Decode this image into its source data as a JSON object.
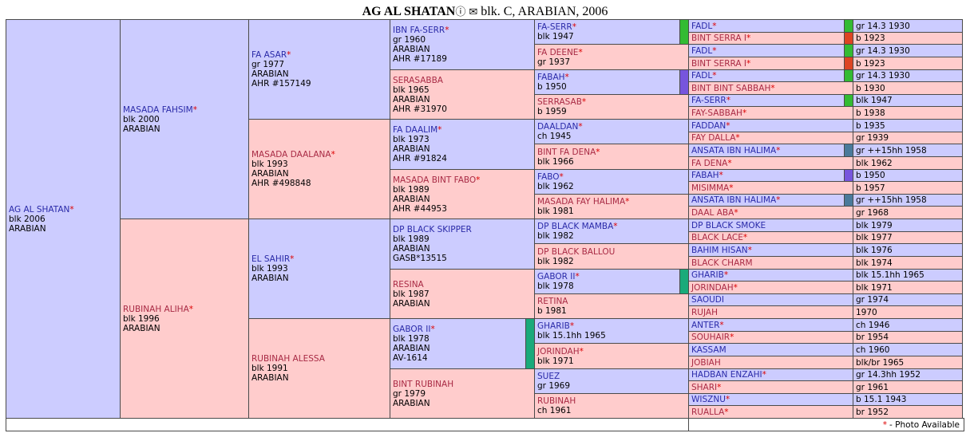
{
  "header": {
    "name": "AG AL SHATAN",
    "info_glyph": "ⓘ",
    "photo_glyph": "✉",
    "details": "blk. C, ARABIAN, 2006"
  },
  "footer": {
    "star": "*",
    "note": "- Photo Available"
  },
  "colors": {
    "male_bg": "#ccccff",
    "female_bg": "#ffcccc",
    "star": "#dd0000"
  },
  "gen1": {
    "name": "AG AL SHATAN",
    "star": true,
    "lines": [
      "blk 2006",
      "ARABIAN"
    ],
    "sex": "m"
  },
  "gen2": [
    {
      "name": "MASADA FAHSIM",
      "star": true,
      "lines": [
        "blk 2000",
        "ARABIAN"
      ],
      "sex": "m"
    },
    {
      "name": "RUBINAH ALIHA",
      "star": true,
      "lines": [
        "blk 1996",
        "ARABIAN"
      ],
      "sex": "f"
    }
  ],
  "gen3": [
    {
      "name": "FA ASAR",
      "star": true,
      "lines": [
        "gr 1977",
        "ARABIAN",
        "AHR #157149"
      ],
      "sex": "m"
    },
    {
      "name": "MASADA DAALANA",
      "star": true,
      "lines": [
        "blk 1993",
        "ARABIAN",
        "AHR #498848"
      ],
      "sex": "f"
    },
    {
      "name": "EL SAHIR",
      "star": true,
      "lines": [
        "blk 1993",
        "ARABIAN"
      ],
      "sex": "m"
    },
    {
      "name": "RUBINAH ALESSA",
      "star": false,
      "lines": [
        "blk 1991",
        "ARABIAN"
      ],
      "sex": "f"
    }
  ],
  "gen4": [
    {
      "name": "IBN FA-SERR",
      "star": true,
      "lines": [
        "gr 1960",
        "ARABIAN",
        "AHR #17189"
      ],
      "sex": "m",
      "swatch": ""
    },
    {
      "name": "SERASABBA",
      "star": false,
      "lines": [
        "blk 1965",
        "ARABIAN",
        "AHR #31970"
      ],
      "sex": "f",
      "swatch": ""
    },
    {
      "name": "FA DAALIM",
      "star": true,
      "lines": [
        "blk 1973",
        "ARABIAN",
        "AHR #91824"
      ],
      "sex": "m",
      "swatch": ""
    },
    {
      "name": "MASADA BINT FABO",
      "star": true,
      "lines": [
        "blk 1989",
        "ARABIAN",
        "AHR #44953"
      ],
      "sex": "f",
      "swatch": ""
    },
    {
      "name": "DP BLACK SKIPPER",
      "star": false,
      "lines": [
        "blk 1989",
        "ARABIAN",
        "GASB*13515"
      ],
      "sex": "m",
      "swatch": ""
    },
    {
      "name": "RESINA",
      "star": false,
      "lines": [
        "blk 1987",
        "ARABIAN"
      ],
      "sex": "f",
      "swatch": ""
    },
    {
      "name": "GABOR II",
      "star": true,
      "lines": [
        "blk 1978",
        "ARABIAN",
        "AV-1614"
      ],
      "sex": "m",
      "swatch": "#1aaa7a"
    },
    {
      "name": "BINT RUBINAH",
      "star": false,
      "lines": [
        "gr 1979",
        "ARABIAN"
      ],
      "sex": "f",
      "swatch": ""
    }
  ],
  "gen5": [
    {
      "name": "FA-SERR",
      "star": true,
      "lines": [
        "blk 1947"
      ],
      "sex": "m",
      "swatch": "#33bb33"
    },
    {
      "name": "FA DEENE",
      "star": true,
      "lines": [
        "gr 1937"
      ],
      "sex": "f",
      "swatch": ""
    },
    {
      "name": "FABAH",
      "star": true,
      "lines": [
        "b 1950"
      ],
      "sex": "m",
      "swatch": "#7755dd"
    },
    {
      "name": "SERRASAB",
      "star": true,
      "lines": [
        "b 1959"
      ],
      "sex": "f",
      "swatch": ""
    },
    {
      "name": "DAALDAN",
      "star": true,
      "lines": [
        "ch 1945"
      ],
      "sex": "m",
      "swatch": ""
    },
    {
      "name": "BINT FA DENA",
      "star": true,
      "lines": [
        "blk 1966"
      ],
      "sex": "f",
      "swatch": ""
    },
    {
      "name": "FABO",
      "star": true,
      "lines": [
        "blk 1962"
      ],
      "sex": "m",
      "swatch": ""
    },
    {
      "name": "MASADA FAY HALIMA",
      "star": true,
      "lines": [
        "blk 1981"
      ],
      "sex": "f",
      "swatch": ""
    },
    {
      "name": "DP BLACK MAMBA",
      "star": true,
      "lines": [
        "blk 1982"
      ],
      "sex": "m",
      "swatch": ""
    },
    {
      "name": "DP BLACK BALLOU",
      "star": false,
      "lines": [
        "blk 1982"
      ],
      "sex": "f",
      "swatch": ""
    },
    {
      "name": "GABOR II",
      "star": true,
      "lines": [
        "blk 1978"
      ],
      "sex": "m",
      "swatch": "#1aaa7a"
    },
    {
      "name": "RETINA",
      "star": false,
      "lines": [
        "b 1981"
      ],
      "sex": "f",
      "swatch": ""
    },
    {
      "name": "GHARIB",
      "star": true,
      "lines": [
        "blk 15.1hh 1965"
      ],
      "sex": "m",
      "swatch": ""
    },
    {
      "name": "JORINDAH",
      "star": true,
      "lines": [
        "blk 1971"
      ],
      "sex": "f",
      "swatch": ""
    },
    {
      "name": "SUEZ",
      "star": false,
      "lines": [
        "gr 1969"
      ],
      "sex": "m",
      "swatch": ""
    },
    {
      "name": "RUBINAH",
      "star": false,
      "lines": [
        "ch 1961"
      ],
      "sex": "f",
      "swatch": ""
    }
  ],
  "gen6": [
    {
      "name": "FADL",
      "star": true,
      "info": "gr 14.3 1930",
      "sex": "m",
      "swatch": "#33bb33"
    },
    {
      "name": "BINT SERRA I",
      "star": true,
      "info": "b 1923",
      "sex": "f",
      "swatch": "#dd4422"
    },
    {
      "name": "FADL",
      "star": true,
      "info": "gr 14.3 1930",
      "sex": "m",
      "swatch": "#33bb33"
    },
    {
      "name": "BINT SERRA I",
      "star": true,
      "info": "b 1923",
      "sex": "f",
      "swatch": "#dd4422"
    },
    {
      "name": "FADL",
      "star": true,
      "info": "gr 14.3 1930",
      "sex": "m",
      "swatch": "#33bb33"
    },
    {
      "name": "BINT BINT SABBAH",
      "star": true,
      "info": "b 1930",
      "sex": "f",
      "swatch": ""
    },
    {
      "name": "FA-SERR",
      "star": true,
      "info": "blk 1947",
      "sex": "m",
      "swatch": "#33bb33"
    },
    {
      "name": "FAY-SABBAH",
      "star": true,
      "info": "b 1938",
      "sex": "f",
      "swatch": ""
    },
    {
      "name": "FADDAN",
      "star": true,
      "info": "b 1935",
      "sex": "m",
      "swatch": ""
    },
    {
      "name": "FAY DALLA",
      "star": true,
      "info": "gr 1939",
      "sex": "f",
      "swatch": ""
    },
    {
      "name": "ANSATA IBN HALIMA",
      "star": true,
      "info": "gr ++15hh 1958",
      "sex": "m",
      "swatch": "#4a7a9a"
    },
    {
      "name": "FA DENA",
      "star": true,
      "info": "blk 1962",
      "sex": "f",
      "swatch": ""
    },
    {
      "name": "FABAH",
      "star": true,
      "info": "b 1950",
      "sex": "m",
      "swatch": "#7755dd"
    },
    {
      "name": "MISIMMA",
      "star": true,
      "info": "b 1957",
      "sex": "f",
      "swatch": ""
    },
    {
      "name": "ANSATA IBN HALIMA",
      "star": true,
      "info": "gr ++15hh 1958",
      "sex": "m",
      "swatch": "#4a7a9a"
    },
    {
      "name": "DAAL ABA",
      "star": true,
      "info": "gr 1968",
      "sex": "f",
      "swatch": ""
    },
    {
      "name": "DP BLACK SMOKE",
      "star": false,
      "info": "blk 1979",
      "sex": "m",
      "swatch": ""
    },
    {
      "name": "BLACK LACE",
      "star": true,
      "info": "blk 1977",
      "sex": "f",
      "swatch": ""
    },
    {
      "name": "BAHIM HISAN",
      "star": true,
      "info": "blk 1976",
      "sex": "m",
      "swatch": ""
    },
    {
      "name": "BLACK CHARM",
      "star": false,
      "info": "blk 1974",
      "sex": "f",
      "swatch": ""
    },
    {
      "name": "GHARIB",
      "star": true,
      "info": "blk 15.1hh 1965",
      "sex": "m",
      "swatch": ""
    },
    {
      "name": "JORINDAH",
      "star": true,
      "info": "blk 1971",
      "sex": "f",
      "swatch": ""
    },
    {
      "name": "SAOUDI",
      "star": false,
      "info": "gr 1974",
      "sex": "m",
      "swatch": ""
    },
    {
      "name": "RUJAH",
      "star": false,
      "info": "1970",
      "sex": "f",
      "swatch": ""
    },
    {
      "name": "ANTER",
      "star": true,
      "info": "ch 1946",
      "sex": "m",
      "swatch": ""
    },
    {
      "name": "SOUHAIR",
      "star": true,
      "info": "br 1954",
      "sex": "f",
      "swatch": ""
    },
    {
      "name": "KASSAM",
      "star": false,
      "info": "ch 1960",
      "sex": "m",
      "swatch": ""
    },
    {
      "name": "JOBIAH",
      "star": false,
      "info": "blk/br 1965",
      "sex": "f",
      "swatch": ""
    },
    {
      "name": "HADBAN ENZAHI",
      "star": true,
      "info": "gr 14.3hh 1952",
      "sex": "m",
      "swatch": ""
    },
    {
      "name": "SHARI",
      "star": true,
      "info": "gr 1961",
      "sex": "f",
      "swatch": ""
    },
    {
      "name": "WISZNU",
      "star": true,
      "info": "b 15.1 1943",
      "sex": "m",
      "swatch": ""
    },
    {
      "name": "RUALLA",
      "star": true,
      "info": "br 1952",
      "sex": "f",
      "swatch": ""
    }
  ]
}
